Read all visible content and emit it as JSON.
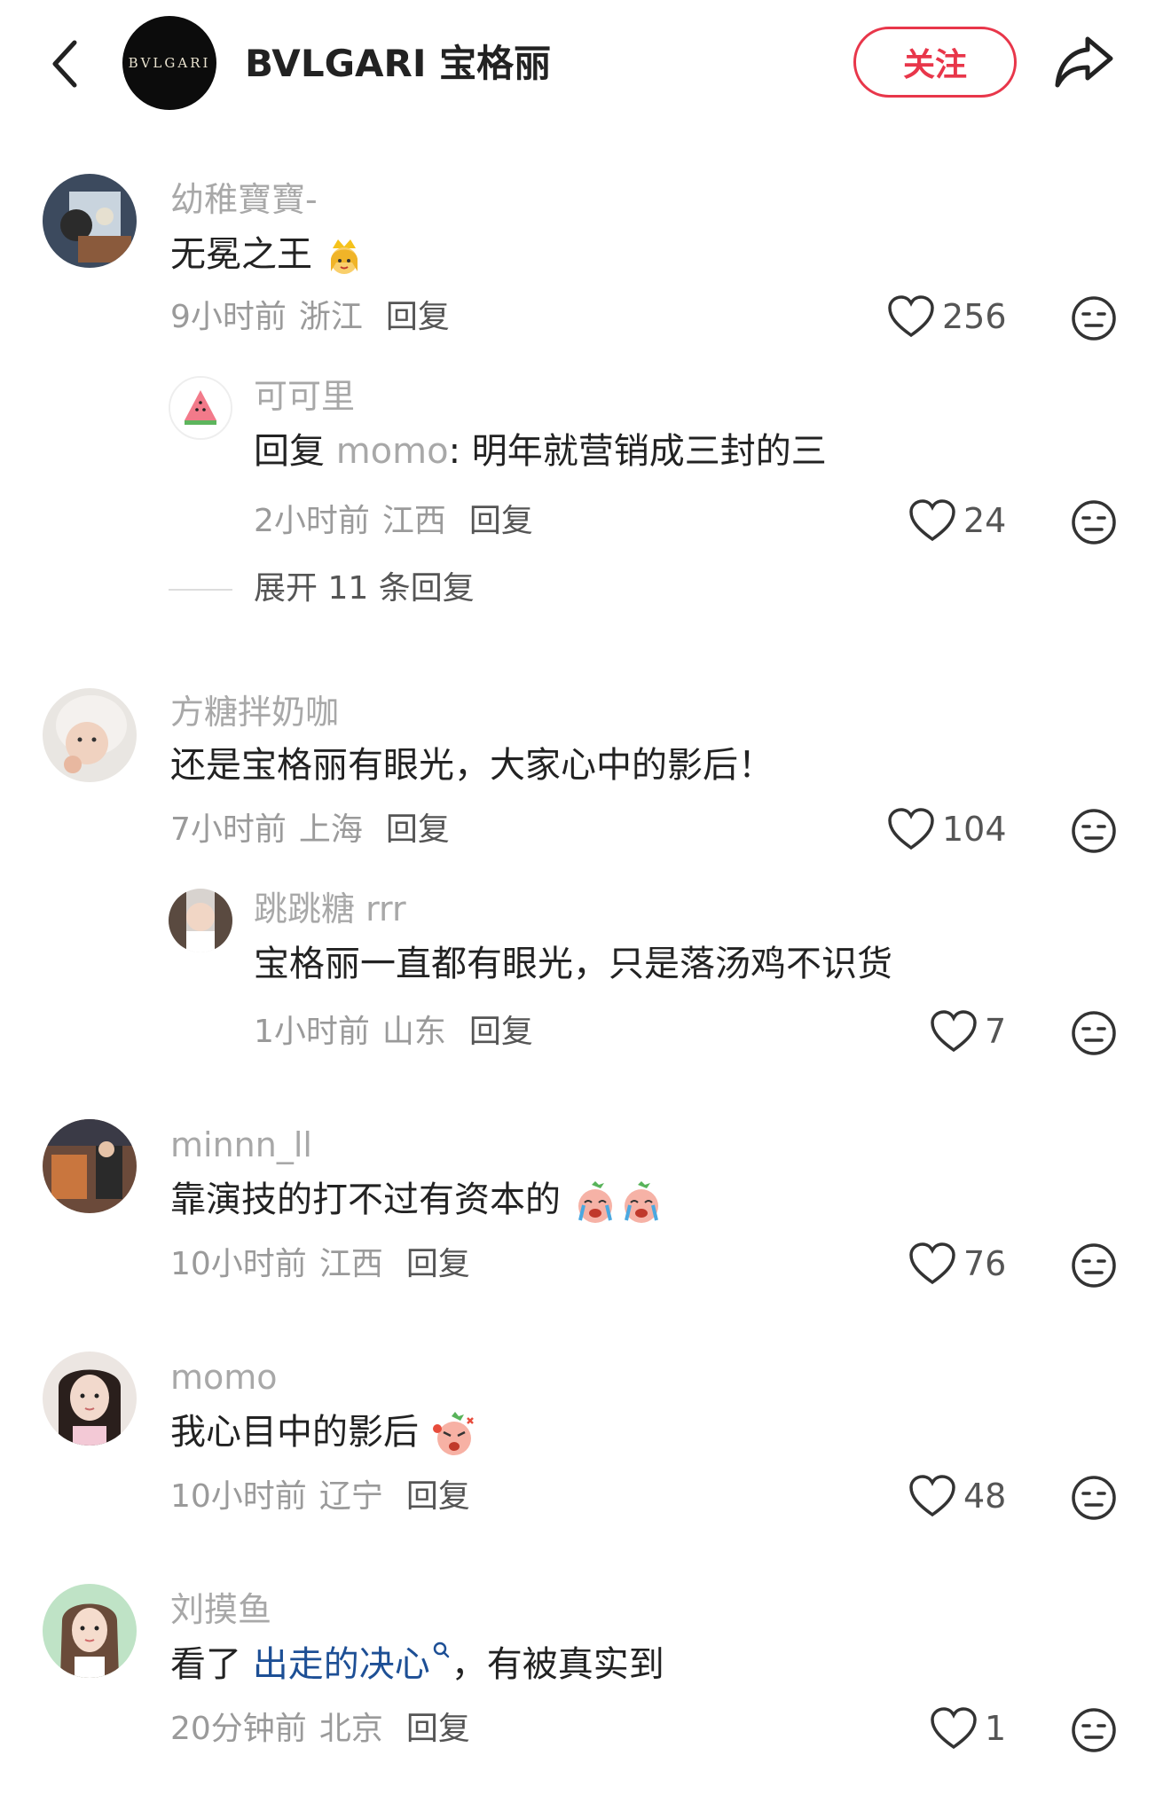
{
  "header": {
    "brand_logo_text": "BVLGARI",
    "title": "BVLGARI 宝格丽",
    "follow_label": "关注"
  },
  "comments": [
    {
      "user": "幼稚寶寶-",
      "text": "无冕之王",
      "emoji": "princess-emoji",
      "time": "9小时前",
      "location": "浙江",
      "reply": "回复",
      "likes": "256"
    },
    {
      "user": "可可里",
      "reply_prefix": "回复",
      "reply_to": "momo",
      "text": ": 明年就营销成三封的三",
      "time": "2小时前",
      "location": "江西",
      "reply": "回复",
      "likes": "24"
    },
    {
      "expand": "展开 11 条回复"
    },
    {
      "user": "方糖拌奶咖",
      "text": "还是宝格丽有眼光，大家心中的影后！",
      "time": "7小时前",
      "location": "上海",
      "reply": "回复",
      "likes": "104"
    },
    {
      "user": "跳跳糖 rrr",
      "text": "宝格丽一直都有眼光，只是落汤鸡不识货",
      "time": "1小时前",
      "location": "山东",
      "reply": "回复",
      "likes": "7"
    },
    {
      "user": "minnn_ll",
      "text": "靠演技的打不过有资本的",
      "emoji": "crying-peach-emoji",
      "time": "10小时前",
      "location": "江西",
      "reply": "回复",
      "likes": "76"
    },
    {
      "user": "momo",
      "text": "我心目中的影后",
      "emoji": "angry-peach-emoji",
      "time": "10小时前",
      "location": "辽宁",
      "reply": "回复",
      "likes": "48"
    },
    {
      "user": "刘摸鱼",
      "text_before": "看了",
      "link": "出走的决心",
      "text_after": "，有被真实到",
      "time": "20分钟前",
      "location": "北京",
      "reply": "回复",
      "likes": "1"
    }
  ],
  "colors": {
    "accent": "#e8364a",
    "link": "#1d4f95",
    "muted": "#a8a8a8"
  }
}
